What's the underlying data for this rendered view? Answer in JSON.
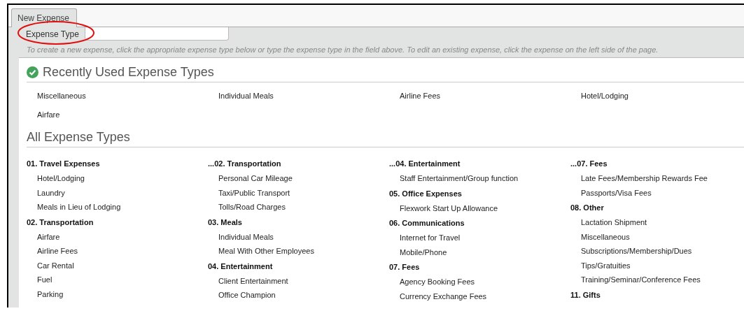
{
  "tabs": [
    {
      "label": "New Expense",
      "selected": true
    }
  ],
  "expense_type_field": {
    "label": "Expense Type"
  },
  "hint": "To create a new expense, click the appropriate expense type below or type the expense type in the field above. To edit an existing expense, click the expense on the left side of the page.",
  "recently_used": {
    "title": "Recently Used Expense Types",
    "items": [
      "Miscellaneous",
      "Individual Meals",
      "Airline Fees",
      "Hotel/Lodging",
      "Airfare"
    ]
  },
  "all_types": {
    "title": "All Expense Types",
    "columns": [
      [
        {
          "heading": "01. Travel Expenses",
          "items": [
            "Hotel/Lodging",
            "Laundry",
            "Meals in Lieu of Lodging"
          ]
        },
        {
          "heading": "02. Transportation",
          "items": [
            "Airfare",
            "Airline Fees",
            "Car Rental",
            "Fuel",
            "Parking"
          ]
        }
      ],
      [
        {
          "heading": "...02. Transportation",
          "items": [
            "Personal Car Mileage",
            "Taxi/Public Transport",
            "Tolls/Road Charges"
          ]
        },
        {
          "heading": "03. Meals",
          "items": [
            "Individual Meals",
            "Meal With Other Employees"
          ]
        },
        {
          "heading": "04. Entertainment",
          "items": [
            "Client Entertainment",
            "Office Champion"
          ]
        }
      ],
      [
        {
          "heading": "...04. Entertainment",
          "items": [
            "Staff Entertainment/Group function"
          ]
        },
        {
          "heading": "05. Office Expenses",
          "items": [
            "Flexwork Start Up Allowance"
          ]
        },
        {
          "heading": "06. Communications",
          "items": [
            "Internet for Travel",
            "Mobile/Phone"
          ]
        },
        {
          "heading": "07. Fees",
          "items": [
            "Agency Booking Fees",
            "Currency Exchange Fees"
          ]
        }
      ],
      [
        {
          "heading": "...07. Fees",
          "items": [
            "Late Fees/Membership Rewards Fee",
            "Passports/Visa Fees"
          ]
        },
        {
          "heading": "08. Other",
          "items": [
            "Lactation Shipment",
            "Miscellaneous",
            "Subscriptions/Membership/Dues",
            "Tips/Gratuities",
            "Training/Seminar/Conference Fees"
          ]
        },
        {
          "heading": "11. Gifts"
        }
      ]
    ]
  }
}
